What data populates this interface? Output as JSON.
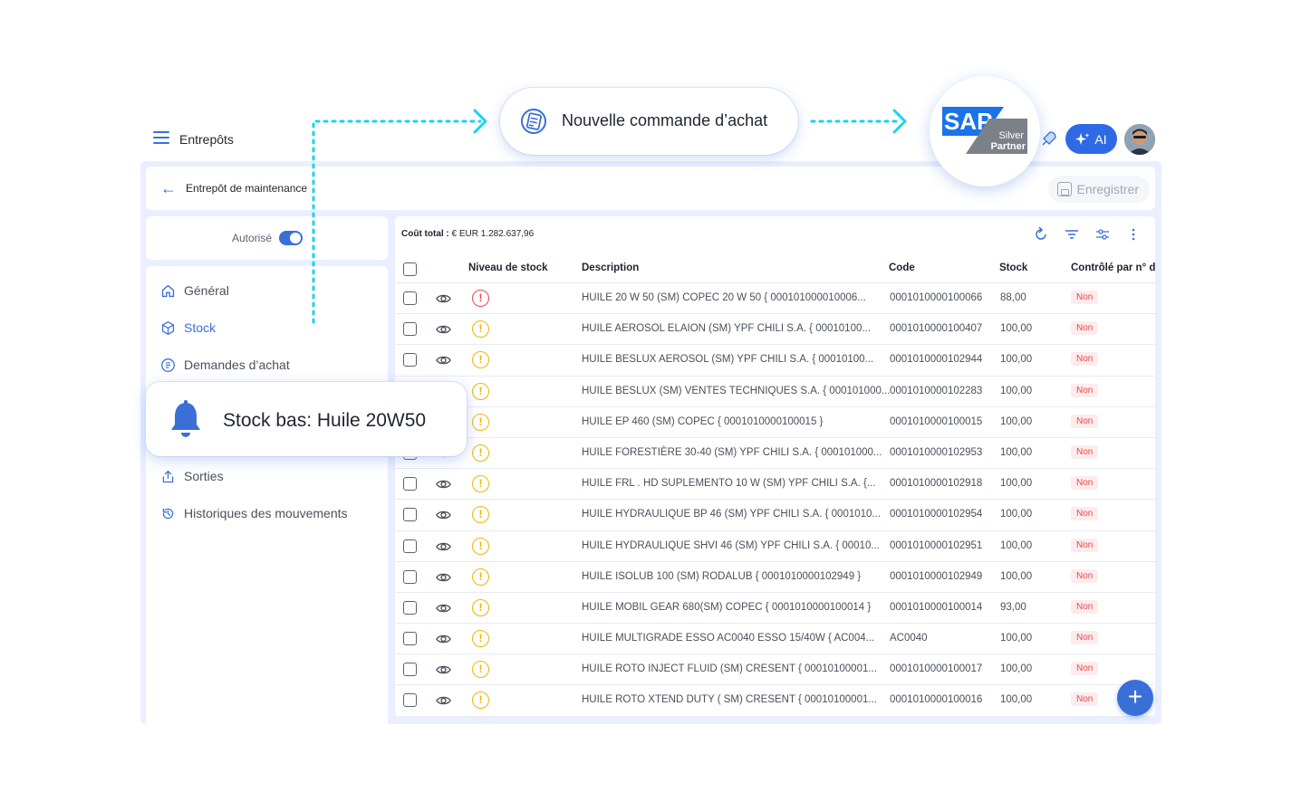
{
  "header": {
    "app_title": "Entrepôts"
  },
  "subheader": {
    "title": "Entrepôt de maintenance",
    "save_label": "Enregistrer"
  },
  "authorized": {
    "label": "Autorisé",
    "enabled": true
  },
  "sidebar": {
    "items": [
      {
        "label": "Général",
        "icon": "home-icon",
        "active": false
      },
      {
        "label": "Stock",
        "icon": "box-icon",
        "active": true
      },
      {
        "label": "Demandes d’achat",
        "icon": "purchase-request-icon",
        "active": false
      },
      {
        "label": "Sorties",
        "icon": "export-icon",
        "active": false
      },
      {
        "label": "Historiques des mouvements",
        "icon": "history-icon",
        "active": false
      }
    ]
  },
  "table": {
    "total_label": "Coût total :",
    "total_value": "€ EUR 1.282.637,96",
    "columns": [
      "Niveau de stock",
      "Description",
      "Code",
      "Stock",
      "Contrôlé par n° de"
    ],
    "rows": [
      {
        "level": "critical",
        "description": "HUILE 20 W 50 (SM) COPEC 20 W 50 { 000101000010006...",
        "code": "0001010000100066",
        "stock": "88,00",
        "controlled": "Non"
      },
      {
        "level": "warning",
        "description": "HUILE AEROSOL ELAION (SM) YPF CHILI S.A. { 00010100...",
        "code": "0001010000100407",
        "stock": "100,00",
        "controlled": "Non"
      },
      {
        "level": "warning",
        "description": "HUILE BESLUX AEROSOL (SM) YPF CHILI S.A. { 00010100...",
        "code": "0001010000102944",
        "stock": "100,00",
        "controlled": "Non"
      },
      {
        "level": "warning",
        "description": "HUILE BESLUX (SM) VENTES TECHNIQUES S.A. { 000101000...",
        "code": "0001010000102283",
        "stock": "100,00",
        "controlled": "Non"
      },
      {
        "level": "warning",
        "description": "HUILE EP 460 (SM) COPEC { 0001010000100015 }",
        "code": "0001010000100015",
        "stock": "100,00",
        "controlled": "Non"
      },
      {
        "level": "warning",
        "description": "HUILE FORESTIÈRE 30-40 (SM) YPF CHILI S.A. { 000101000...",
        "code": "0001010000102953",
        "stock": "100,00",
        "controlled": "Non"
      },
      {
        "level": "warning",
        "description": "HUILE FRL . HD SUPLEMENTO 10 W (SM) YPF CHILI S.A. {...",
        "code": "0001010000102918",
        "stock": "100,00",
        "controlled": "Non"
      },
      {
        "level": "warning",
        "description": "HUILE HYDRAULIQUE BP 46 (SM) YPF CHILI S.A. { 0001010...",
        "code": "0001010000102954",
        "stock": "100,00",
        "controlled": "Non"
      },
      {
        "level": "warning",
        "description": "HUILE HYDRAULIQUE SHVI 46 (SM) YPF CHILI S.A. { 00010...",
        "code": "0001010000102951",
        "stock": "100,00",
        "controlled": "Non"
      },
      {
        "level": "warning",
        "description": "HUILE ISOLUB 100 (SM) RODALUB { 0001010000102949 }",
        "code": "0001010000102949",
        "stock": "100,00",
        "controlled": "Non"
      },
      {
        "level": "warning",
        "description": "HUILE MOBIL GEAR 680(SM) COPEC { 0001010000100014 }",
        "code": "0001010000100014",
        "stock": "93,00",
        "controlled": "Non"
      },
      {
        "level": "warning",
        "description": "HUILE MULTIGRADE ESSO AC0040 ESSO 15/40W { AC004...",
        "code": "AC0040",
        "stock": "100,00",
        "controlled": "Non"
      },
      {
        "level": "warning",
        "description": "HUILE ROTO INJECT FLUID (SM) CRESENT { 00010100001...",
        "code": "0001010000100017",
        "stock": "100,00",
        "controlled": "Non"
      },
      {
        "level": "warning",
        "description": "HUILE ROTO XTEND DUTY ( SM) CRESENT { 00010100001...",
        "code": "0001010000100016",
        "stock": "100,00",
        "controlled": "Non"
      }
    ]
  },
  "overlay": {
    "purchase_order_label": "Nouvelle commande d’achat",
    "notification_text": "Stock bas: Huile 20W50",
    "sap_logo_text": "SAP",
    "sap_badge_line1": "Silver",
    "sap_badge_line2": "Partner",
    "ai_label": "AI"
  },
  "colors": {
    "accent": "#3b6fd8",
    "warning": "#f0b400",
    "critical": "#e5484d",
    "flow_line": "#19d3f2"
  }
}
